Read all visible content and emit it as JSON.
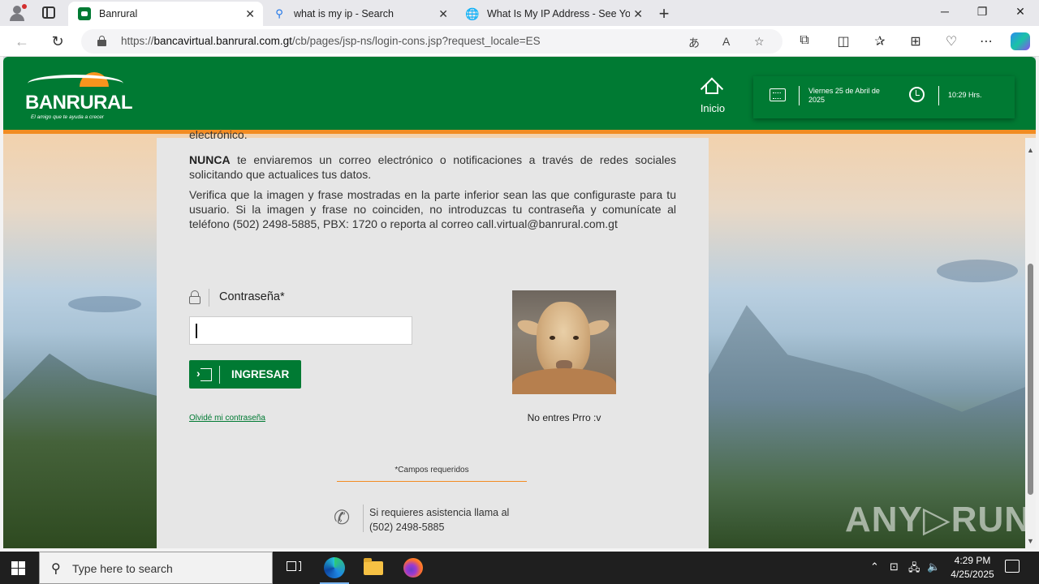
{
  "browser": {
    "tabs": [
      {
        "title": "Banrural",
        "active": true
      },
      {
        "title": "what is my ip - Search",
        "active": false
      },
      {
        "title": "What Is My IP Address - See Your",
        "active": false
      }
    ],
    "url_prefix": "https://",
    "url_host": "bancavirtual.banrural.com.gt",
    "url_path": "/cb/pages/jsp-ns/login-cons.jsp?request_locale=ES"
  },
  "header": {
    "logo_text": "BANRURAL",
    "logo_tagline": "El amigo que te ayuda a crecer",
    "home_label": "Inicio",
    "date": "Viernes 25 de Abril de 2025",
    "time": "10:29 Hrs."
  },
  "notice": {
    "cut_text": "electrónico.",
    "p1_bold": "NUNCA",
    "p1_rest": " te enviaremos un correo electrónico o notificaciones a través de redes sociales solicitando que actualices tus datos.",
    "p2": "Verifica que la imagen y frase mostradas en la parte inferior sean las que configuraste para tu usuario. Si la imagen y frase no coinciden, no introduzcas tu contraseña y comunícate al teléfono (502) 2498-5885, PBX: 1720 o reporta al correo call.virtual@banrural.com.gt"
  },
  "login": {
    "password_label": "Contraseña*",
    "password_value": "",
    "submit_label": "INGRESAR",
    "forgot_label": "Olvidé mi contraseña",
    "security_phrase": "No entres Prro :v",
    "required_note": "*Campos requeridos",
    "assist_line1": "Si requieres asistencia llama al",
    "assist_line2": "(502) 2498-5885"
  },
  "watermark": "ANY RUN",
  "taskbar": {
    "search_placeholder": "Type here to search",
    "time": "4:29 PM",
    "date": "4/25/2025"
  },
  "colors": {
    "brand_green": "#007a33",
    "accent_orange": "#f28c22"
  }
}
